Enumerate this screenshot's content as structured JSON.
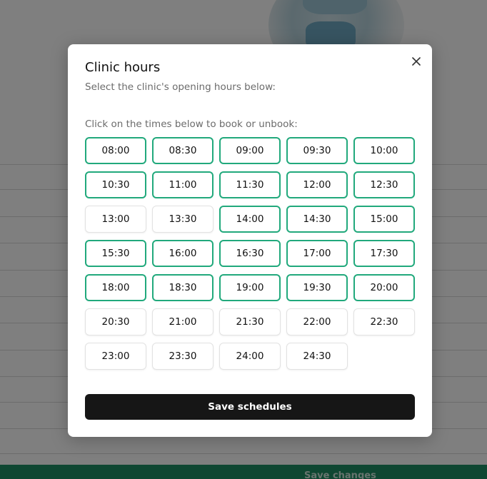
{
  "background": {
    "footer_button_label": "Save changes"
  },
  "modal": {
    "title": "Clinic hours",
    "subtitle": "Select the clinic's opening hours below:",
    "close_icon": "close-icon",
    "instruction": "Click on the times below to book or unbook:",
    "save_label": "Save schedules",
    "accent_color": "#21a97c",
    "time_slots": [
      {
        "time": "08:00",
        "booked": true
      },
      {
        "time": "08:30",
        "booked": true
      },
      {
        "time": "09:00",
        "booked": true
      },
      {
        "time": "09:30",
        "booked": true
      },
      {
        "time": "10:00",
        "booked": true
      },
      {
        "time": "10:30",
        "booked": true
      },
      {
        "time": "11:00",
        "booked": true
      },
      {
        "time": "11:30",
        "booked": true
      },
      {
        "time": "12:00",
        "booked": true
      },
      {
        "time": "12:30",
        "booked": true
      },
      {
        "time": "13:00",
        "booked": false
      },
      {
        "time": "13:30",
        "booked": false
      },
      {
        "time": "14:00",
        "booked": true
      },
      {
        "time": "14:30",
        "booked": true
      },
      {
        "time": "15:00",
        "booked": true
      },
      {
        "time": "15:30",
        "booked": true
      },
      {
        "time": "16:00",
        "booked": true
      },
      {
        "time": "16:30",
        "booked": true
      },
      {
        "time": "17:00",
        "booked": true
      },
      {
        "time": "17:30",
        "booked": true
      },
      {
        "time": "18:00",
        "booked": true
      },
      {
        "time": "18:30",
        "booked": true
      },
      {
        "time": "19:00",
        "booked": true
      },
      {
        "time": "19:30",
        "booked": true
      },
      {
        "time": "20:00",
        "booked": true
      },
      {
        "time": "20:30",
        "booked": false
      },
      {
        "time": "21:00",
        "booked": false
      },
      {
        "time": "21:30",
        "booked": false
      },
      {
        "time": "22:00",
        "booked": false
      },
      {
        "time": "22:30",
        "booked": false
      },
      {
        "time": "23:00",
        "booked": false
      },
      {
        "time": "23:30",
        "booked": false
      },
      {
        "time": "24:00",
        "booked": false
      },
      {
        "time": "24:30",
        "booked": false
      }
    ]
  }
}
